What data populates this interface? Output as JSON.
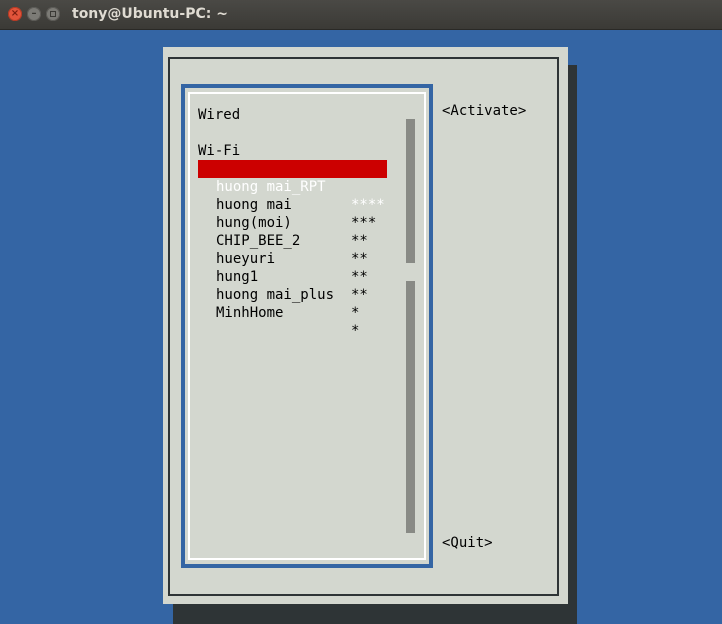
{
  "window": {
    "title": "tony@Ubuntu-PC: ~",
    "close_glyph": "×",
    "minimize_glyph": "–"
  },
  "list": {
    "wired_header": "Wired",
    "wifi_header": "Wi-Fi",
    "networks": [
      {
        "ssid": "huong mai_RPT",
        "signal": "****",
        "selected": true
      },
      {
        "ssid": "huong mai",
        "signal": "***",
        "selected": false
      },
      {
        "ssid": "hung(moi)",
        "signal": "**",
        "selected": false
      },
      {
        "ssid": "CHIP_BEE_2",
        "signal": "**",
        "selected": false
      },
      {
        "ssid": "hueyuri",
        "signal": "**",
        "selected": false
      },
      {
        "ssid": "hung1",
        "signal": "**",
        "selected": false
      },
      {
        "ssid": "huong mai_plus",
        "signal": "*",
        "selected": false
      },
      {
        "ssid": "MinhHome",
        "signal": "*",
        "selected": false
      }
    ]
  },
  "buttons": {
    "activate": "<Activate>",
    "quit": "<Quit>"
  },
  "colors": {
    "background": "#3465a4",
    "dialog": "#d3d7cf",
    "selection": "#cc0000"
  }
}
